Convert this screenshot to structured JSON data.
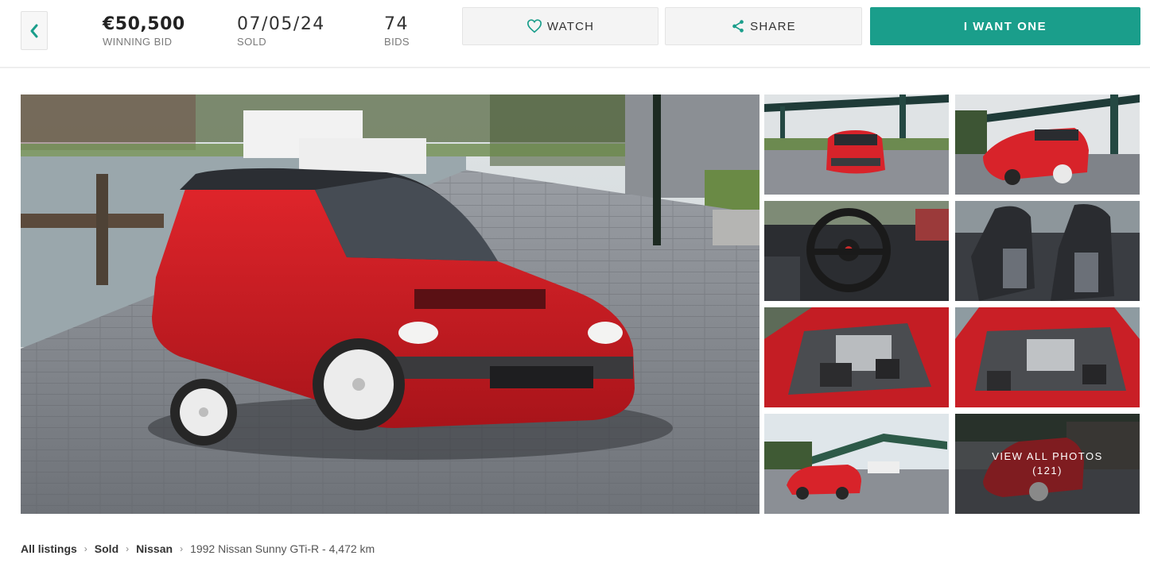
{
  "header": {
    "winning_bid": {
      "value": "€50,500",
      "label": "WINNING BID"
    },
    "sold_date": {
      "value": "07/05/24",
      "label": "SOLD"
    },
    "bids": {
      "value": "74",
      "label": "BIDS"
    },
    "watch_label": "WATCH",
    "share_label": "SHARE",
    "want_label": "I WANT ONE",
    "accent_color": "#1a9e8b"
  },
  "icons": {
    "back": "chevron-left-icon",
    "watch": "heart-icon",
    "share": "share-icon"
  },
  "gallery": {
    "main_photo": "red-hatchback-front-three-quarter",
    "thumbnails": [
      "red-hatchback-front-under-bridge",
      "red-hatchback-front-three-quarter-bridge",
      "steering-wheel-interior",
      "front-seats-interior",
      "engine-bay-left",
      "engine-bay-right",
      "car-by-canal-bridge",
      "car-rear-view-all"
    ],
    "view_all_line1": "VIEW ALL PHOTOS",
    "view_all_line2": "(121)"
  },
  "breadcrumb": {
    "items": [
      "All listings",
      "Sold",
      "Nissan"
    ],
    "current": "1992 Nissan Sunny GTi-R - 4,472 km"
  }
}
